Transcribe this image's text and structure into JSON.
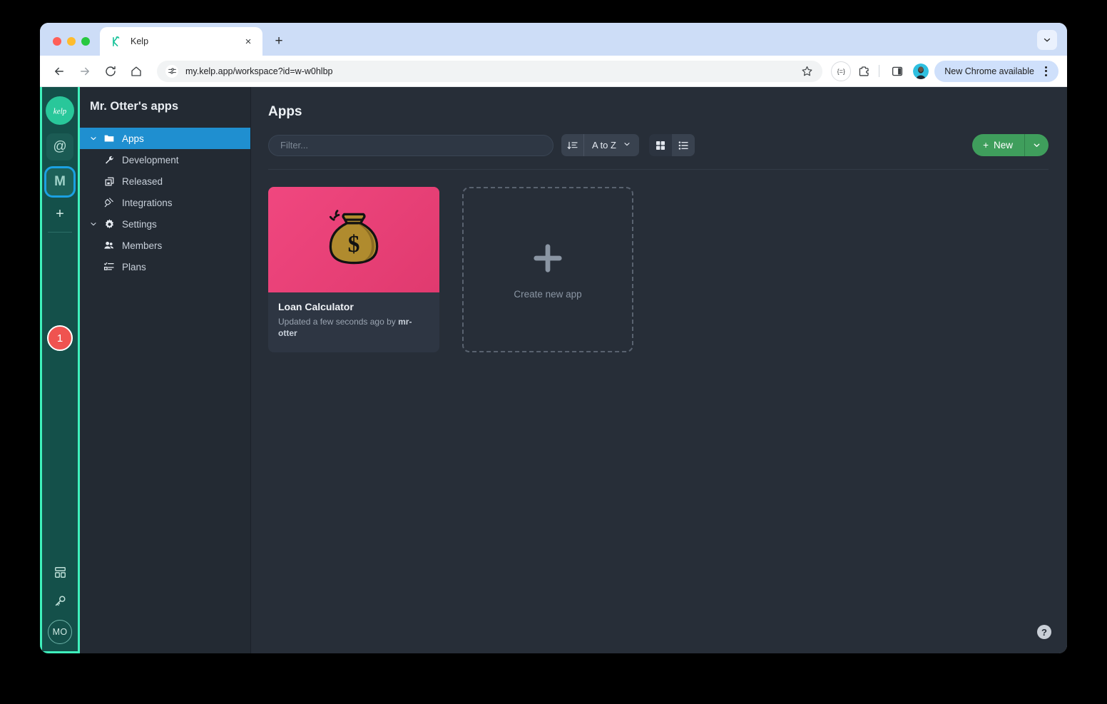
{
  "browser": {
    "traffic_lights": [
      "close",
      "minimize",
      "maximize"
    ],
    "tab": {
      "title": "Kelp",
      "favicon": "kelp-logo-icon",
      "close_label": "×"
    },
    "new_tab_label": "+",
    "tab_list_icon": "chevron-down-icon",
    "nav": {
      "back": "back-arrow-icon",
      "forward": "forward-arrow-icon",
      "reload": "reload-icon",
      "home": "home-icon"
    },
    "url": "my.kelp.app/workspace?id=w-w0hlbp",
    "site_info_icon": "tune-settings-icon",
    "bookmark_icon": "star-icon",
    "translate_label": "{=}",
    "extensions_icon": "extensions-puzzle-icon",
    "side_panel_icon": "side-panel-icon",
    "profile_avatar": "user-avatar",
    "update_pill_label": "New Chrome available",
    "menu_icon": "three-dots-vertical-icon"
  },
  "rail": {
    "logo_label": "kelp",
    "tiles": [
      {
        "name": "at-mention-tile",
        "label": "@"
      },
      {
        "name": "workspace-m-tile",
        "label": "M"
      }
    ],
    "add_label": "+",
    "badge_count": "1",
    "bottom_icons": [
      {
        "name": "dashboard-layout-icon"
      },
      {
        "name": "key-icon"
      }
    ],
    "user_initials": "MO",
    "accent_color": "#3ff0bc",
    "selected_ring_color": "#1ba1e2",
    "badge_color": "#ef5350"
  },
  "sidebar": {
    "workspace_title": "Mr. Otter's apps",
    "items": [
      {
        "label": "Apps",
        "icon": "folder-icon",
        "chevron": "chevron-down-icon",
        "selected": true,
        "indent": 0
      },
      {
        "label": "Development",
        "icon": "wrench-icon",
        "chevron": "",
        "selected": false,
        "indent": 1
      },
      {
        "label": "Released",
        "icon": "copy-stack-icon",
        "chevron": "",
        "selected": false,
        "indent": 1
      },
      {
        "label": "Integrations",
        "icon": "plug-icon",
        "chevron": "",
        "selected": false,
        "indent": 0
      },
      {
        "label": "Settings",
        "icon": "gear-icon",
        "chevron": "chevron-down-icon",
        "selected": false,
        "indent": 0
      },
      {
        "label": "Members",
        "icon": "members-icon",
        "chevron": "",
        "selected": false,
        "indent": 1
      },
      {
        "label": "Plans",
        "icon": "plans-list-icon",
        "chevron": "",
        "selected": false,
        "indent": 1
      }
    ],
    "selected_color": "#1f8fd0"
  },
  "main": {
    "page_title": "Apps",
    "filter_placeholder": "Filter...",
    "filter_value": "",
    "sort_direction_icon": "sort-ascending-icon",
    "sort_value": "A to Z",
    "sort_chevron": "chevron-down-icon",
    "view_grid_icon": "grid-view-icon",
    "view_list_icon": "list-view-icon",
    "view_active": "grid",
    "new_button_label": "New",
    "new_button_plus": "+",
    "new_dropdown_icon": "chevron-down-icon",
    "new_button_color": "#3f9e5c",
    "help_label": "?",
    "cards": [
      {
        "title": "Loan Calculator",
        "meta_prefix": "Updated a few seconds ago by ",
        "meta_author": "mr-otter",
        "thumb_icon": "money-bag-icon",
        "thumb_color": "#e83e70"
      }
    ],
    "create_card": {
      "plus_icon": "plus-icon",
      "label": "Create new app"
    }
  }
}
